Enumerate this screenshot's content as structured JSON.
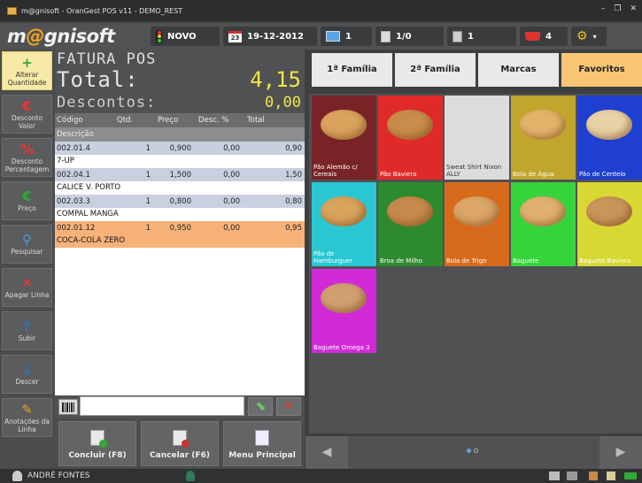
{
  "window": {
    "title": "m@gnisoft - OranGest POS v11 - DEMO_REST"
  },
  "topbar": {
    "logo_pre": "m",
    "logo_at": "@",
    "logo_post": "gnisoft",
    "novo_label": "NOVO",
    "date": "19-12-2012",
    "date_day_icon": "23",
    "monitor_count": "1",
    "pages": "1/0",
    "calc_count": "1",
    "basket_count": "4"
  },
  "sidebar": [
    {
      "icon": "alterar-quantidade-icon",
      "glyph": "+",
      "label": "Alterar Quantidade",
      "active": true
    },
    {
      "icon": "euro-icon",
      "glyph": "€",
      "label": "Desconto Valor"
    },
    {
      "icon": "percent-icon",
      "glyph": "%",
      "label": "Desconto Percentagem"
    },
    {
      "icon": "euro-green-icon",
      "glyph": "€",
      "label": "Preço"
    },
    {
      "icon": "search-icon",
      "glyph": "⚲",
      "label": "Pesquisar"
    },
    {
      "icon": "x-icon",
      "glyph": "✕",
      "label": "Apagar Linha"
    },
    {
      "icon": "up-arrow-icon",
      "glyph": "↑",
      "label": "Subir"
    },
    {
      "icon": "down-arrow-icon",
      "glyph": "↓",
      "label": "Descer"
    },
    {
      "icon": "notes-icon",
      "glyph": "✎",
      "label": "Anotações da Linha"
    }
  ],
  "fatura": {
    "title": "FATURA POS",
    "total_label": "Total:",
    "total_value": "4,15",
    "descontos_label": "Descontos:",
    "descontos_value": "0,00"
  },
  "table": {
    "headers": [
      "Código",
      "Qtd.",
      "Preço",
      "Desc. %",
      "Total"
    ],
    "subheader": "Descrição",
    "rows": [
      {
        "codigo": "002.01.4",
        "qtd": "1",
        "preco": "0,900",
        "desc": "0,00",
        "total": "0,90",
        "descricao": "7-UP"
      },
      {
        "codigo": "002.04.1",
        "qtd": "1",
        "preco": "1,500",
        "desc": "0,00",
        "total": "1,50",
        "descricao": "CALICE V. PORTO"
      },
      {
        "codigo": "002.03.3",
        "qtd": "1",
        "preco": "0,800",
        "desc": "0,00",
        "total": "0,80",
        "descricao": "COMPAL MANGA"
      },
      {
        "codigo": "002.01.12",
        "qtd": "1",
        "preco": "0,950",
        "desc": "0,00",
        "total": "0,95",
        "descricao": "COCA-COLA ZERO",
        "selected": true
      }
    ]
  },
  "input": {
    "value": ""
  },
  "bottom_buttons": [
    {
      "label": "Concluir (F8)",
      "icon": "concluir-doc-icon"
    },
    {
      "label": "Cancelar (F6)",
      "icon": "cancelar-doc-icon"
    },
    {
      "label": "Menu Principal",
      "icon": "menu-doc-icon"
    }
  ],
  "tabs": [
    {
      "label": "1ª Família"
    },
    {
      "label": "2ª Família"
    },
    {
      "label": "Marcas"
    },
    {
      "label": "Favoritos",
      "active": true
    }
  ],
  "products": [
    {
      "label": "Pão Alemão c/ Cereais",
      "bg": "#7a2326"
    },
    {
      "label": "Pão Baviera",
      "bg": "#e02a2a"
    },
    {
      "label": "Sweat Shirt Nixon ALLY",
      "bg": "#dcdcdc"
    },
    {
      "label": "Bola de Água",
      "bg": "#c1a62e"
    },
    {
      "label": "Pão de Centeio",
      "bg": "#1f3fd1"
    },
    {
      "label": "Pão de Hamburguer",
      "bg": "#2ac7d3"
    },
    {
      "label": "Broa de Milho",
      "bg": "#2e8a2e"
    },
    {
      "label": "Bola de Trigo",
      "bg": "#d86a1c"
    },
    {
      "label": "Baguete",
      "bg": "#35d43a"
    },
    {
      "label": "Baguete Baviera",
      "bg": "#d8d834"
    },
    {
      "label": "Baguete Omega 3",
      "bg": "#d32ad8"
    }
  ],
  "status": {
    "user": "ANDRÉ FONTES"
  }
}
